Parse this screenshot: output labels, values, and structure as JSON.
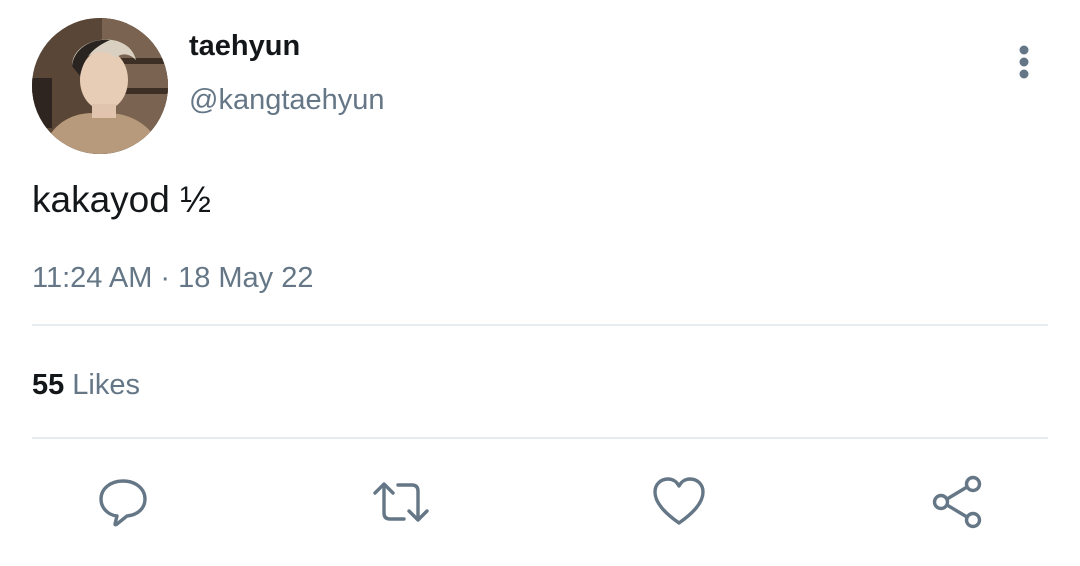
{
  "author": {
    "display_name": "taehyun",
    "handle": "@kangtaehyun"
  },
  "tweet": {
    "text": "kakayod ½",
    "time": "11:24 AM",
    "separator": "·",
    "date": "18 May 22"
  },
  "stats": {
    "likes_count": "55",
    "likes_label": "Likes"
  },
  "actions": {
    "reply_icon": "reply-icon",
    "retweet_icon": "retweet-icon",
    "like_icon": "heart-icon",
    "share_icon": "share-icon"
  },
  "colors": {
    "primary_text": "#14171a",
    "secondary_text": "#657786",
    "icon": "#657786",
    "divider": "#e6ecf0"
  }
}
